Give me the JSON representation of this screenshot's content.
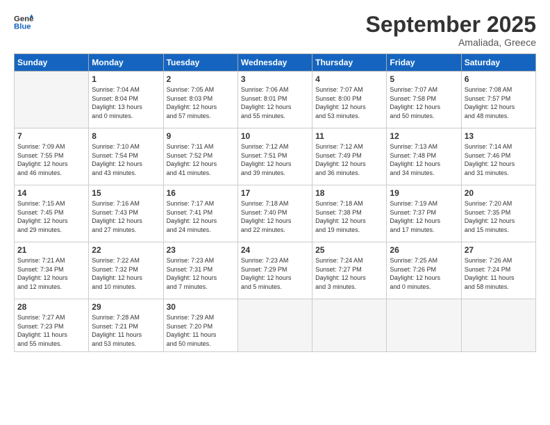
{
  "logo": {
    "line1": "General",
    "line2": "Blue"
  },
  "title": "September 2025",
  "subtitle": "Amaliada, Greece",
  "header": {
    "days": [
      "Sunday",
      "Monday",
      "Tuesday",
      "Wednesday",
      "Thursday",
      "Friday",
      "Saturday"
    ]
  },
  "weeks": [
    [
      {
        "day": "",
        "info": ""
      },
      {
        "day": "1",
        "info": "Sunrise: 7:04 AM\nSunset: 8:04 PM\nDaylight: 13 hours\nand 0 minutes."
      },
      {
        "day": "2",
        "info": "Sunrise: 7:05 AM\nSunset: 8:03 PM\nDaylight: 12 hours\nand 57 minutes."
      },
      {
        "day": "3",
        "info": "Sunrise: 7:06 AM\nSunset: 8:01 PM\nDaylight: 12 hours\nand 55 minutes."
      },
      {
        "day": "4",
        "info": "Sunrise: 7:07 AM\nSunset: 8:00 PM\nDaylight: 12 hours\nand 53 minutes."
      },
      {
        "day": "5",
        "info": "Sunrise: 7:07 AM\nSunset: 7:58 PM\nDaylight: 12 hours\nand 50 minutes."
      },
      {
        "day": "6",
        "info": "Sunrise: 7:08 AM\nSunset: 7:57 PM\nDaylight: 12 hours\nand 48 minutes."
      }
    ],
    [
      {
        "day": "7",
        "info": "Sunrise: 7:09 AM\nSunset: 7:55 PM\nDaylight: 12 hours\nand 46 minutes."
      },
      {
        "day": "8",
        "info": "Sunrise: 7:10 AM\nSunset: 7:54 PM\nDaylight: 12 hours\nand 43 minutes."
      },
      {
        "day": "9",
        "info": "Sunrise: 7:11 AM\nSunset: 7:52 PM\nDaylight: 12 hours\nand 41 minutes."
      },
      {
        "day": "10",
        "info": "Sunrise: 7:12 AM\nSunset: 7:51 PM\nDaylight: 12 hours\nand 39 minutes."
      },
      {
        "day": "11",
        "info": "Sunrise: 7:12 AM\nSunset: 7:49 PM\nDaylight: 12 hours\nand 36 minutes."
      },
      {
        "day": "12",
        "info": "Sunrise: 7:13 AM\nSunset: 7:48 PM\nDaylight: 12 hours\nand 34 minutes."
      },
      {
        "day": "13",
        "info": "Sunrise: 7:14 AM\nSunset: 7:46 PM\nDaylight: 12 hours\nand 31 minutes."
      }
    ],
    [
      {
        "day": "14",
        "info": "Sunrise: 7:15 AM\nSunset: 7:45 PM\nDaylight: 12 hours\nand 29 minutes."
      },
      {
        "day": "15",
        "info": "Sunrise: 7:16 AM\nSunset: 7:43 PM\nDaylight: 12 hours\nand 27 minutes."
      },
      {
        "day": "16",
        "info": "Sunrise: 7:17 AM\nSunset: 7:41 PM\nDaylight: 12 hours\nand 24 minutes."
      },
      {
        "day": "17",
        "info": "Sunrise: 7:18 AM\nSunset: 7:40 PM\nDaylight: 12 hours\nand 22 minutes."
      },
      {
        "day": "18",
        "info": "Sunrise: 7:18 AM\nSunset: 7:38 PM\nDaylight: 12 hours\nand 19 minutes."
      },
      {
        "day": "19",
        "info": "Sunrise: 7:19 AM\nSunset: 7:37 PM\nDaylight: 12 hours\nand 17 minutes."
      },
      {
        "day": "20",
        "info": "Sunrise: 7:20 AM\nSunset: 7:35 PM\nDaylight: 12 hours\nand 15 minutes."
      }
    ],
    [
      {
        "day": "21",
        "info": "Sunrise: 7:21 AM\nSunset: 7:34 PM\nDaylight: 12 hours\nand 12 minutes."
      },
      {
        "day": "22",
        "info": "Sunrise: 7:22 AM\nSunset: 7:32 PM\nDaylight: 12 hours\nand 10 minutes."
      },
      {
        "day": "23",
        "info": "Sunrise: 7:23 AM\nSunset: 7:31 PM\nDaylight: 12 hours\nand 7 minutes."
      },
      {
        "day": "24",
        "info": "Sunrise: 7:23 AM\nSunset: 7:29 PM\nDaylight: 12 hours\nand 5 minutes."
      },
      {
        "day": "25",
        "info": "Sunrise: 7:24 AM\nSunset: 7:27 PM\nDaylight: 12 hours\nand 3 minutes."
      },
      {
        "day": "26",
        "info": "Sunrise: 7:25 AM\nSunset: 7:26 PM\nDaylight: 12 hours\nand 0 minutes."
      },
      {
        "day": "27",
        "info": "Sunrise: 7:26 AM\nSunset: 7:24 PM\nDaylight: 11 hours\nand 58 minutes."
      }
    ],
    [
      {
        "day": "28",
        "info": "Sunrise: 7:27 AM\nSunset: 7:23 PM\nDaylight: 11 hours\nand 55 minutes."
      },
      {
        "day": "29",
        "info": "Sunrise: 7:28 AM\nSunset: 7:21 PM\nDaylight: 11 hours\nand 53 minutes."
      },
      {
        "day": "30",
        "info": "Sunrise: 7:29 AM\nSunset: 7:20 PM\nDaylight: 11 hours\nand 50 minutes."
      },
      {
        "day": "",
        "info": ""
      },
      {
        "day": "",
        "info": ""
      },
      {
        "day": "",
        "info": ""
      },
      {
        "day": "",
        "info": ""
      }
    ]
  ]
}
